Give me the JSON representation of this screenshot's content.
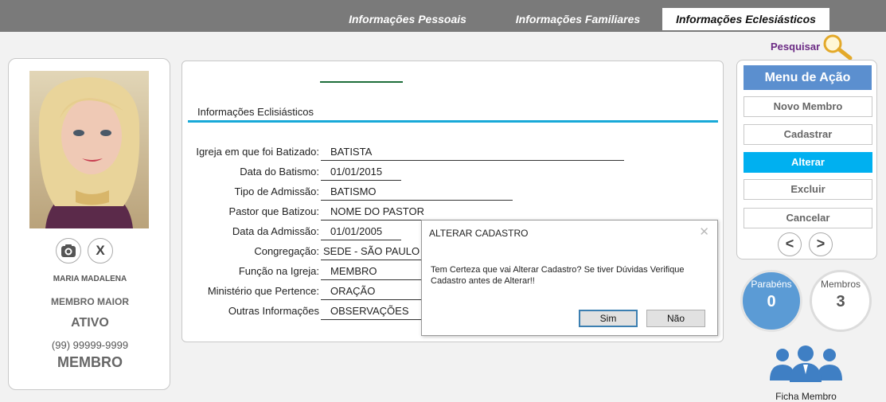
{
  "tabs": [
    {
      "label": "Informações Pessoais",
      "active": false
    },
    {
      "label": "Informações Familiares",
      "active": false
    },
    {
      "label": "Informações Eclesiásticos",
      "active": true
    }
  ],
  "search": {
    "label": "Pesquisar",
    "icon": "magnifier-icon"
  },
  "member": {
    "name": "MARIA MADALENA",
    "category": "MEMBRO MAIOR",
    "status": "ATIVO",
    "phone": "(99) 99999-9999",
    "role": "MEMBRO",
    "photo_button_icon": "camera-icon",
    "remove_photo_label": "X"
  },
  "section": {
    "title": "Informações Eclisiásticos",
    "fields": [
      {
        "label": "Igreja em que foi Batizado:",
        "value": "BATISTA"
      },
      {
        "label": "Data do Batismo:",
        "value": "01/01/2015"
      },
      {
        "label": "Tipo de Admissão:",
        "value": "BATISMO"
      },
      {
        "label": "Pastor que Batizou:",
        "value": "NOME DO PASTOR"
      },
      {
        "label": "Data da Admissão:",
        "value": "01/01/2005"
      },
      {
        "label": "Congregação:",
        "value": "SEDE - SÃO PAULO"
      },
      {
        "label": "Função na Igreja:",
        "value": "MEMBRO"
      },
      {
        "label": "Ministério que Pertence:",
        "value": "ORAÇÃO"
      },
      {
        "label": "Outras Informações",
        "value": "OBSERVAÇÕES"
      }
    ]
  },
  "dialog": {
    "title": "ALTERAR CADASTRO",
    "message": "Tem Certeza que vai Alterar Cadastro? Se tiver Dúvidas Verifique Cadastro antes de Alterar!!",
    "yes_label": "Sim",
    "no_label": "Não"
  },
  "menu": {
    "title": "Menu de Ação",
    "items": [
      {
        "label": "Novo Membro",
        "active": false
      },
      {
        "label": "Cadastrar",
        "active": false
      },
      {
        "label": "Alterar",
        "active": true
      },
      {
        "label": "Excluir",
        "active": false
      },
      {
        "label": "Cancelar",
        "active": false
      }
    ],
    "prev_label": "<",
    "next_label": ">"
  },
  "stats": {
    "parabens": {
      "label": "Parabéns",
      "value": "0"
    },
    "membros": {
      "label": "Membros",
      "value": "3"
    }
  },
  "ficha": {
    "label": "Ficha Membro",
    "icon": "people-group-icon"
  },
  "colors": {
    "accent": "#00b0f0",
    "menu_title": "#5b8fcf",
    "section_line": "#18a9d8",
    "purple": "#6b2a84"
  }
}
